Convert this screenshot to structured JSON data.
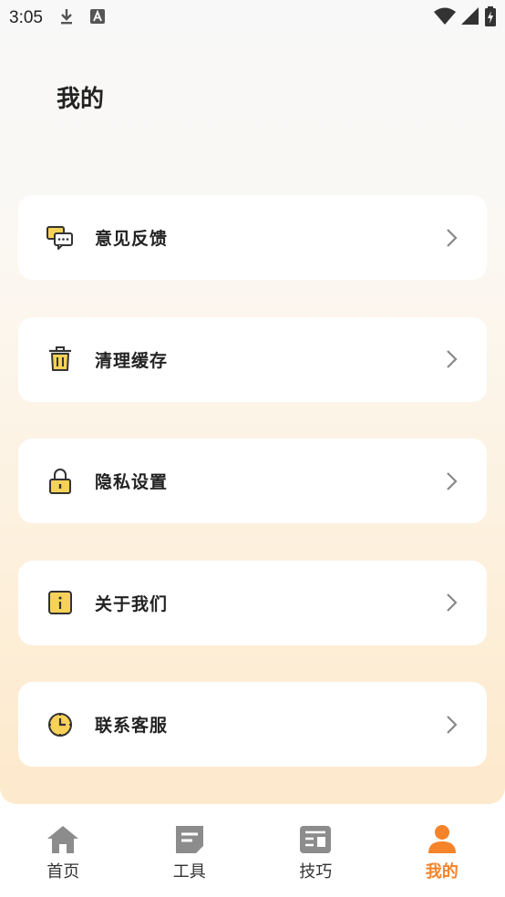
{
  "status_bar": {
    "time": "3:05",
    "icons": [
      "download-icon",
      "a-icon",
      "wifi-icon",
      "signal-icon",
      "battery-icon"
    ]
  },
  "page": {
    "title": "我的"
  },
  "menu": {
    "items": [
      {
        "label": "意见反馈",
        "icon": "feedback-chat-icon"
      },
      {
        "label": "清理缓存",
        "icon": "trash-icon"
      },
      {
        "label": "隐私设置",
        "icon": "lock-icon"
      },
      {
        "label": "关于我们",
        "icon": "info-icon"
      },
      {
        "label": "联系客服",
        "icon": "clock-icon"
      }
    ]
  },
  "tab_bar": {
    "tabs": [
      {
        "label": "首页",
        "icon": "home-icon",
        "active": false
      },
      {
        "label": "工具",
        "icon": "tools-icon",
        "active": false
      },
      {
        "label": "技巧",
        "icon": "tips-icon",
        "active": false
      },
      {
        "label": "我的",
        "icon": "profile-icon",
        "active": true
      }
    ]
  },
  "colors": {
    "accent": "#f5832a",
    "icon_yellow": "#f7d258",
    "icon_stroke": "#333333",
    "inactive_tab": "#8c8c8c"
  }
}
